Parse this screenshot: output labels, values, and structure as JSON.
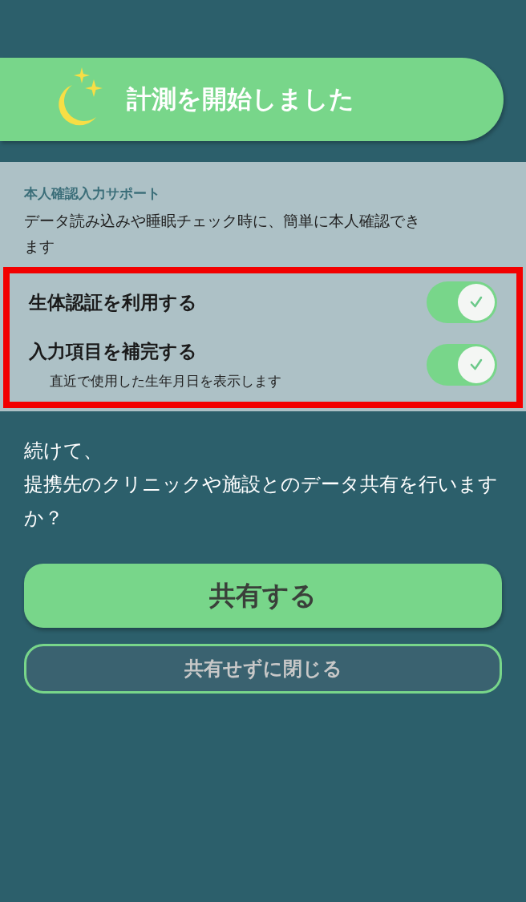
{
  "banner": {
    "title": "計測を開始しました"
  },
  "support": {
    "heading": "本人確認入力サポート",
    "description": "データ読み込みや睡眠チェック時に、簡単に本人確認できます",
    "highlighted": true,
    "settings": [
      {
        "label": "生体認証を利用する",
        "on": true
      },
      {
        "label": "入力項目を補完する",
        "note": "直近で使用した生年月日を表示します",
        "on": true
      }
    ]
  },
  "question": [
    "続けて、",
    "提携先のクリニックや施設とのデータ共有を行いますか？"
  ],
  "buttons": [
    {
      "label": "共有する",
      "kind": "primary"
    },
    {
      "label": "共有せずに閉じる",
      "kind": "secondary"
    }
  ]
}
